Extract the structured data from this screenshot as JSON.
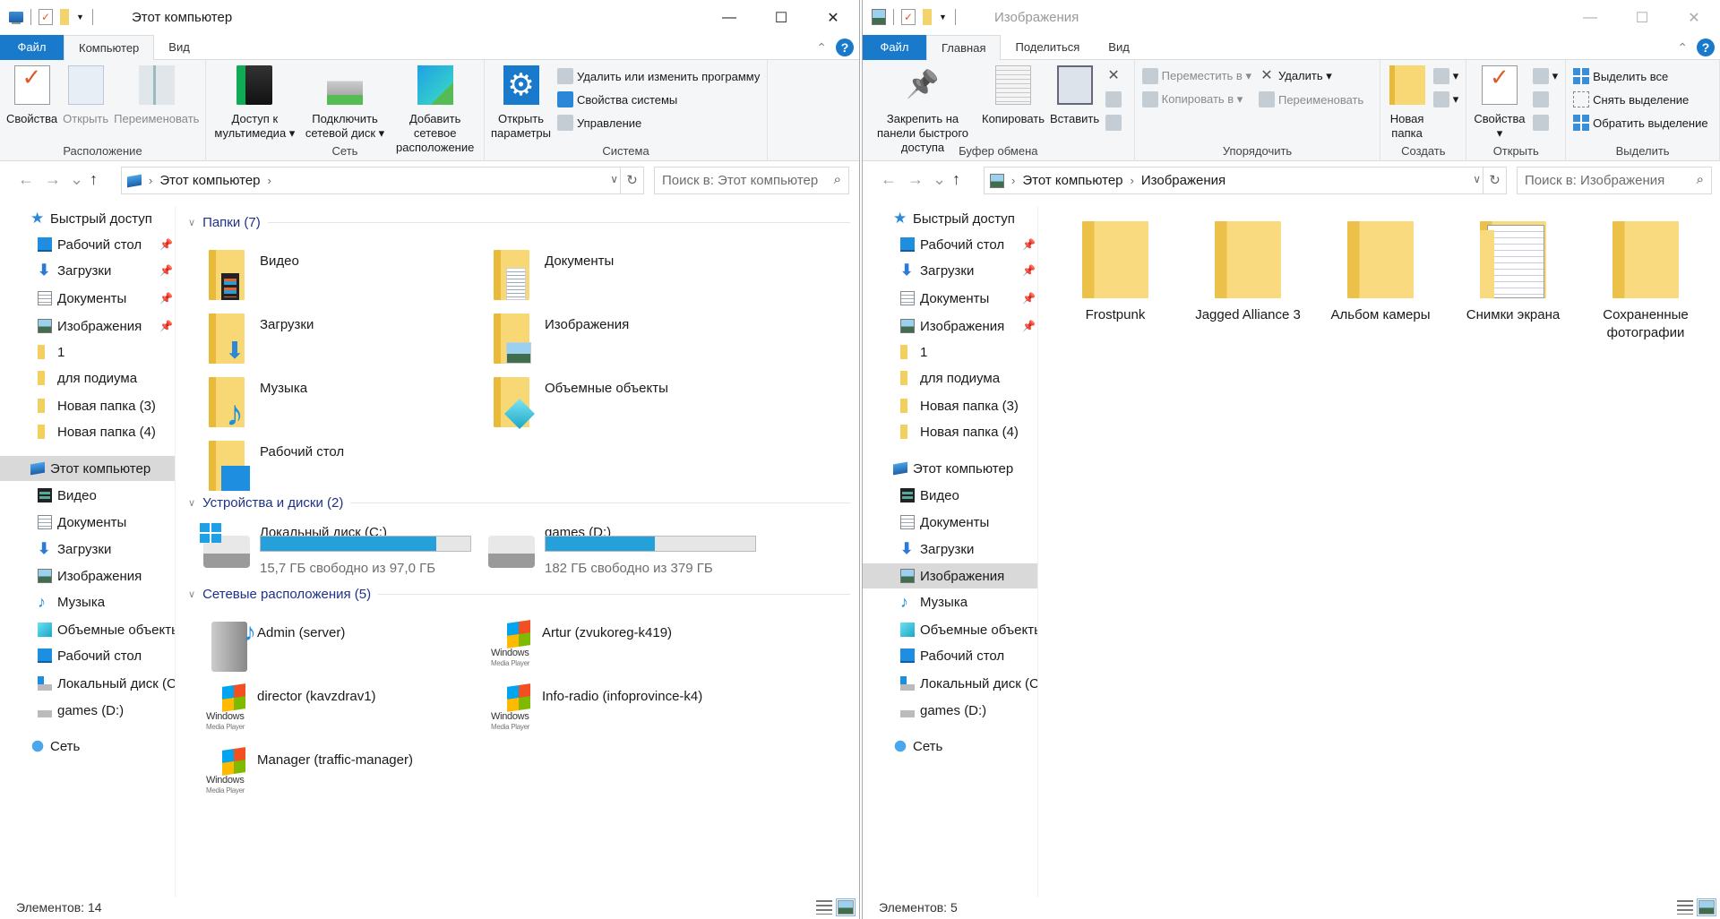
{
  "windows": [
    {
      "title": "Этот компьютер",
      "active": true,
      "tabs": [
        "Файл",
        "Компьютер",
        "Вид"
      ],
      "active_tab": 1,
      "ribbon": [
        {
          "label": "Расположение",
          "items": [
            {
              "kind": "big",
              "icon": "check",
              "label": "Свойства"
            },
            {
              "kind": "big",
              "icon": "doc",
              "label": "Открыть",
              "disabled": true
            },
            {
              "kind": "big",
              "icon": "rename",
              "label": "Переименовать",
              "disabled": true
            }
          ]
        },
        {
          "label": "Сеть",
          "items": [
            {
              "kind": "big",
              "icon": "media",
              "label": "Доступ к мультимедиа ▾"
            },
            {
              "kind": "big",
              "icon": "netdrive",
              "label": "Подключить сетевой диск ▾"
            },
            {
              "kind": "big",
              "icon": "netloc",
              "label": "Добавить сетевое расположение"
            }
          ]
        },
        {
          "label": "Система",
          "items": [
            {
              "kind": "big",
              "icon": "gear",
              "label": "Открыть параметры"
            },
            {
              "kind": "col",
              "items": [
                {
                  "icon": "sm-g",
                  "label": "Удалить или изменить программу"
                },
                {
                  "icon": "sm-b",
                  "label": "Свойства системы"
                },
                {
                  "icon": "sm-g",
                  "label": "Управление"
                }
              ]
            }
          ]
        }
      ],
      "address": {
        "icon": "pc",
        "path": [
          "Этот компьютер"
        ],
        "search_placeholder": "Поиск в: Этот компьютер"
      },
      "nav": [
        {
          "label": "Быстрый доступ",
          "icon": "star",
          "level": 0
        },
        {
          "label": "Рабочий стол",
          "icon": "desktop",
          "level": 1,
          "pinned": true
        },
        {
          "label": "Загрузки",
          "icon": "downloads",
          "level": 1,
          "pinned": true
        },
        {
          "label": "Документы",
          "icon": "documents",
          "level": 1,
          "pinned": true
        },
        {
          "label": "Изображения",
          "icon": "pictures",
          "level": 1,
          "pinned": true
        },
        {
          "label": "1",
          "icon": "folder",
          "level": 1
        },
        {
          "label": "для подиума",
          "icon": "folder",
          "level": 1
        },
        {
          "label": "Новая папка (3)",
          "icon": "folder",
          "level": 1
        },
        {
          "label": "Новая папка (4)",
          "icon": "folder",
          "level": 1
        },
        {
          "label": "Этот компьютер",
          "icon": "pc",
          "level": 0,
          "selected": true
        },
        {
          "label": "Видео",
          "icon": "video",
          "level": 1
        },
        {
          "label": "Документы",
          "icon": "documents",
          "level": 1
        },
        {
          "label": "Загрузки",
          "icon": "downloads",
          "level": 1
        },
        {
          "label": "Изображения",
          "icon": "pictures",
          "level": 1
        },
        {
          "label": "Музыка",
          "icon": "music",
          "level": 1
        },
        {
          "label": "Объемные объекты",
          "icon": "objects",
          "level": 1
        },
        {
          "label": "Рабочий стол",
          "icon": "desktop",
          "level": 1
        },
        {
          "label": "Локальный диск (C:)",
          "icon": "drivec",
          "level": 1
        },
        {
          "label": "games (D:)",
          "icon": "drive",
          "level": 1
        },
        {
          "label": "Сеть",
          "icon": "network",
          "level": 0
        }
      ],
      "sections": [
        {
          "title": "Папки (7)",
          "type": "folders",
          "items": [
            {
              "name": "Видео",
              "icon": "video"
            },
            {
              "name": "Документы",
              "icon": "documents"
            },
            {
              "name": "Загрузки",
              "icon": "downloads"
            },
            {
              "name": "Изображения",
              "icon": "pictures"
            },
            {
              "name": "Музыка",
              "icon": "music"
            },
            {
              "name": "Объемные объекты",
              "icon": "objects"
            },
            {
              "name": "Рабочий стол",
              "icon": "desktop"
            }
          ]
        },
        {
          "title": "Устройства и диски (2)",
          "type": "drives",
          "items": [
            {
              "name": "Локальный диск (C:)",
              "icon": "system-drive",
              "free": "15,7 ГБ свободно из 97,0 ГБ",
              "used_fraction": 0.838
            },
            {
              "name": "games (D:)",
              "icon": "drive",
              "free": "182 ГБ свободно из 379 ГБ",
              "used_fraction": 0.52
            }
          ]
        },
        {
          "title": "Сетевые расположения (5)",
          "type": "network",
          "items": [
            {
              "name": "Admin (server)",
              "icon": "media-server"
            },
            {
              "name": "Artur (zvukoreg-k419)",
              "icon": "wmp"
            },
            {
              "name": "director (kavzdrav1)",
              "icon": "wmp"
            },
            {
              "name": "Info-radio (infoprovince-k4)",
              "icon": "wmp"
            },
            {
              "name": "Manager (traffic-manager)",
              "icon": "wmp"
            }
          ]
        }
      ],
      "wmp_logo_text": [
        "Windows",
        "Media Player"
      ],
      "status": "Элементов: 14"
    },
    {
      "title": "Изображения",
      "active": false,
      "tabs": [
        "Файл",
        "Главная",
        "Поделиться",
        "Вид"
      ],
      "active_tab": 1,
      "ribbon": [
        {
          "label": "Буфер обмена",
          "items": [
            {
              "kind": "big",
              "icon": "pin",
              "label": "Закрепить на панели быстрого доступа"
            },
            {
              "kind": "big",
              "icon": "copy",
              "label": "Копировать"
            },
            {
              "kind": "big",
              "icon": "paste",
              "label": "Вставить"
            },
            {
              "kind": "col",
              "items": [
                {
                  "icon": "sm-x",
                  "label": ""
                },
                {
                  "icon": "sm-g",
                  "label": ""
                },
                {
                  "icon": "sm-g",
                  "label": ""
                }
              ]
            }
          ]
        },
        {
          "label": "Упорядочить",
          "items": [
            {
              "kind": "col",
              "items": [
                {
                  "icon": "sm-g",
                  "label": "Переместить в ▾",
                  "disabled": true
                },
                {
                  "icon": "sm-g",
                  "label": "Копировать в ▾",
                  "disabled": true
                }
              ]
            },
            {
              "kind": "col",
              "items": [
                {
                  "icon": "sm-x",
                  "label": "Удалить ▾"
                },
                {
                  "icon": "sm-g",
                  "label": "Переименовать",
                  "disabled": true
                }
              ]
            }
          ]
        },
        {
          "label": "Создать",
          "items": [
            {
              "kind": "big",
              "icon": "folder",
              "label": "Новая папка"
            },
            {
              "kind": "col",
              "items": [
                {
                  "icon": "sm-g",
                  "label": "▾"
                },
                {
                  "icon": "sm-g",
                  "label": "▾"
                }
              ]
            }
          ]
        },
        {
          "label": "Открыть",
          "items": [
            {
              "kind": "big",
              "icon": "check",
              "label": "Свойства ▾"
            },
            {
              "kind": "col",
              "items": [
                {
                  "icon": "sm-g",
                  "label": "▾"
                },
                {
                  "icon": "sm-g",
                  "label": ""
                },
                {
                  "icon": "sm-g",
                  "label": ""
                }
              ]
            }
          ]
        },
        {
          "label": "Выделить",
          "items": [
            {
              "kind": "col",
              "items": [
                {
                  "icon": "grid",
                  "label": "Выделить все"
                },
                {
                  "icon": "grid2",
                  "label": "Снять выделение"
                },
                {
                  "icon": "grid",
                  "label": "Обратить выделение"
                }
              ]
            }
          ]
        }
      ],
      "address": {
        "icon": "pictures",
        "path": [
          "Этот компьютер",
          "Изображения"
        ],
        "search_placeholder": "Поиск в: Изображения"
      },
      "nav": [
        {
          "label": "Быстрый доступ",
          "icon": "star",
          "level": 0
        },
        {
          "label": "Рабочий стол",
          "icon": "desktop",
          "level": 1,
          "pinned": true
        },
        {
          "label": "Загрузки",
          "icon": "downloads",
          "level": 1,
          "pinned": true
        },
        {
          "label": "Документы",
          "icon": "documents",
          "level": 1,
          "pinned": true
        },
        {
          "label": "Изображения",
          "icon": "pictures",
          "level": 1,
          "pinned": true
        },
        {
          "label": "1",
          "icon": "folder",
          "level": 1
        },
        {
          "label": "для подиума",
          "icon": "folder",
          "level": 1
        },
        {
          "label": "Новая папка (3)",
          "icon": "folder",
          "level": 1
        },
        {
          "label": "Новая папка (4)",
          "icon": "folder",
          "level": 1
        },
        {
          "label": "Этот компьютер",
          "icon": "pc",
          "level": 0
        },
        {
          "label": "Видео",
          "icon": "video",
          "level": 1
        },
        {
          "label": "Документы",
          "icon": "documents",
          "level": 1
        },
        {
          "label": "Загрузки",
          "icon": "downloads",
          "level": 1
        },
        {
          "label": "Изображения",
          "icon": "pictures",
          "level": 1,
          "selected": true
        },
        {
          "label": "Музыка",
          "icon": "music",
          "level": 1
        },
        {
          "label": "Объемные объекты",
          "icon": "objects",
          "level": 1
        },
        {
          "label": "Рабочий стол",
          "icon": "desktop",
          "level": 1
        },
        {
          "label": "Локальный диск (C:)",
          "icon": "drivec",
          "level": 1
        },
        {
          "label": "games (D:)",
          "icon": "drive",
          "level": 1
        },
        {
          "label": "Сеть",
          "icon": "network",
          "level": 0
        }
      ],
      "folders": [
        {
          "name": "Frostpunk",
          "icon": "folder"
        },
        {
          "name": "Jagged Alliance 3",
          "icon": "folder"
        },
        {
          "name": "Альбом камеры",
          "icon": "folder"
        },
        {
          "name": "Снимки экрана",
          "icon": "folder-with-preview"
        },
        {
          "name": "Сохраненные фотографии",
          "icon": "folder"
        }
      ],
      "status": "Элементов: 5"
    }
  ]
}
